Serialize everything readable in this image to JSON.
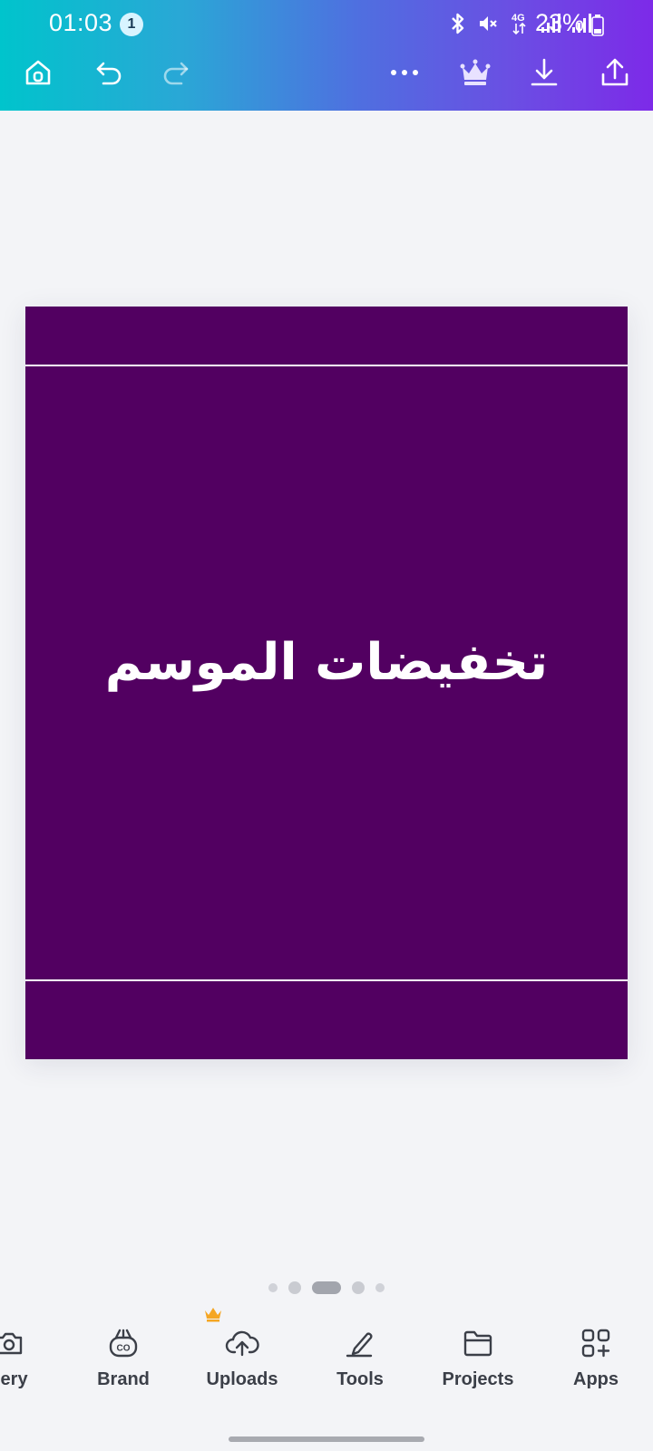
{
  "status_bar": {
    "time": "01:03",
    "notification_count": "1",
    "battery": "23%",
    "network": "4G"
  },
  "toolbar": {
    "home_icon": "home-icon",
    "undo_icon": "undo-icon",
    "redo_icon": "redo-icon",
    "more_icon": "more-icon",
    "premium_icon": "crown-icon",
    "download_icon": "download-icon",
    "share_icon": "share-icon"
  },
  "design": {
    "background_color": "#520061",
    "headline": "تخفيضات الموسم"
  },
  "pager": {
    "pages": 5,
    "active": 3
  },
  "bottom_nav": {
    "items": [
      {
        "label": "llery",
        "icon": "camera-icon"
      },
      {
        "label": "Brand",
        "icon": "brand-kit-icon",
        "premium": true
      },
      {
        "label": "Uploads",
        "icon": "cloud-upload-icon"
      },
      {
        "label": "Tools",
        "icon": "pen-icon"
      },
      {
        "label": "Projects",
        "icon": "folder-icon"
      },
      {
        "label": "Apps",
        "icon": "apps-grid-icon"
      }
    ]
  },
  "colors": {
    "gradient_start": "#00c4cc",
    "gradient_end": "#7d2ae8",
    "premium_crown": "#f5a623"
  }
}
